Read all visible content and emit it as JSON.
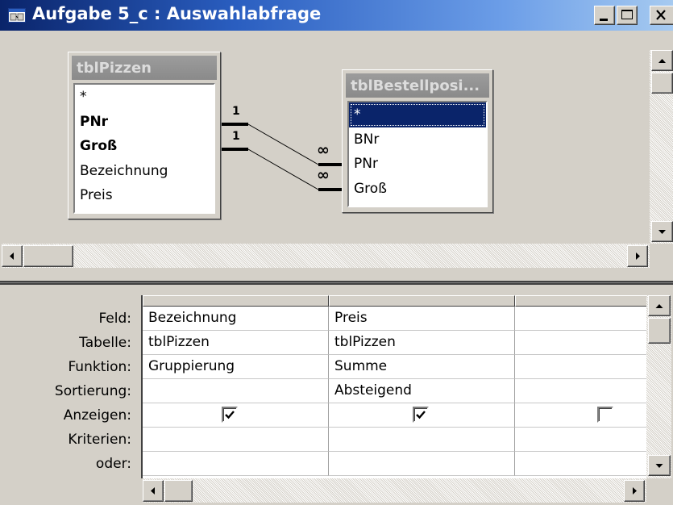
{
  "window": {
    "title": "Aufgabe 5_c : Auswahlabfrage",
    "minimize_icon": "minimize-icon",
    "maximize_icon": "maximize-icon",
    "close_icon": "close-icon"
  },
  "tables": [
    {
      "name": "tblPizzen",
      "fields": [
        {
          "label": "*",
          "bold": false,
          "selected": false
        },
        {
          "label": "PNr",
          "bold": true,
          "selected": false
        },
        {
          "label": "Groß",
          "bold": true,
          "selected": false
        },
        {
          "label": "Bezeichnung",
          "bold": false,
          "selected": false
        },
        {
          "label": "Preis",
          "bold": false,
          "selected": false
        }
      ]
    },
    {
      "name": "tblBestellposi...",
      "fields": [
        {
          "label": "*",
          "bold": false,
          "selected": true
        },
        {
          "label": "BNr",
          "bold": false,
          "selected": false
        },
        {
          "label": "PNr",
          "bold": false,
          "selected": false
        },
        {
          "label": "Groß",
          "bold": false,
          "selected": false
        }
      ]
    }
  ],
  "relationships": [
    {
      "one_label": "1",
      "many_label": "∞"
    },
    {
      "one_label": "1",
      "many_label": "∞"
    }
  ],
  "grid": {
    "row_labels": [
      "Feld:",
      "Tabelle:",
      "Funktion:",
      "Sortierung:",
      "Anzeigen:",
      "Kriterien:",
      "oder:"
    ],
    "columns": [
      {
        "feld": "Bezeichnung",
        "tabelle": "tblPizzen",
        "funktion": "Gruppierung",
        "sortierung": "",
        "anzeigen": true,
        "kriterien": "",
        "oder": ""
      },
      {
        "feld": "Preis",
        "tabelle": "tblPizzen",
        "funktion": "Summe",
        "sortierung": "Absteigend",
        "anzeigen": true,
        "kriterien": "",
        "oder": ""
      },
      {
        "feld": "",
        "tabelle": "",
        "funktion": "",
        "sortierung": "",
        "anzeigen": false,
        "kriterien": "",
        "oder": ""
      }
    ]
  },
  "colors": {
    "titlebar_start": "#0a246a",
    "titlebar_end": "#a6caf0",
    "selection": "#0a246a",
    "face": "#d4d0c8"
  }
}
